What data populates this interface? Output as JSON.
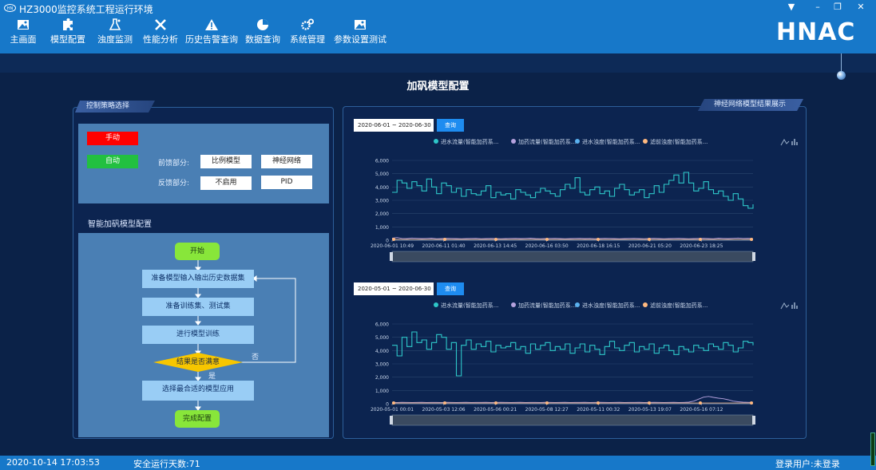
{
  "app": {
    "title": "HZ3000监控系统工程运行环境",
    "brand": "HNAC"
  },
  "window": {
    "dropdown": "▼",
    "minimize": "–",
    "restore": "❐",
    "close": "✕"
  },
  "menu": [
    {
      "label": "主画面",
      "icon": "picture-icon"
    },
    {
      "label": "模型配置",
      "icon": "puzzle-icon"
    },
    {
      "label": "浊度监测",
      "icon": "flask-icon"
    },
    {
      "label": "性能分析",
      "icon": "tools-icon"
    },
    {
      "label": "历史告警查询",
      "icon": "warning-icon"
    },
    {
      "label": "数据查询",
      "icon": "pie-chart-icon"
    },
    {
      "label": "系统管理",
      "icon": "gears-icon"
    },
    {
      "label": "参数设置测试",
      "icon": "picture-icon"
    }
  ],
  "page": {
    "title": "加矾模型配置"
  },
  "left": {
    "tab": "控制策略选择",
    "manual": "手动",
    "auto": "自动",
    "feedforward_label": "前馈部分:",
    "feedforward_a": "比例模型",
    "feedforward_b": "神经网络",
    "feedback_label": "反馈部分:",
    "feedback_a": "不启用",
    "feedback_b": "PID",
    "flow_title": "智能加矾模型配置",
    "flow": {
      "start": "开始",
      "s1": "准备模型输入输出历史数据集",
      "s2": "准备训练集、测试集",
      "s3": "进行模型训练",
      "decision": "结果是否满意",
      "yes": "是",
      "no": "否",
      "s4": "选择最合适的模型应用",
      "end": "完成配置"
    }
  },
  "right": {
    "tab": "神经网络模型结果展示",
    "query": "查询"
  },
  "colors": {
    "series1": "#2ec7c9",
    "series2": "#b6a2de",
    "series3": "#5ab1ef",
    "series4": "#ffb980",
    "manual": "#ff0000",
    "auto": "#22c040"
  },
  "chart_data": [
    {
      "type": "line",
      "date_range": "2020-06-01 ~ 2020-06-30",
      "legend": [
        "进水流量(智能加药系...",
        "加药流量(智能加药系...",
        "进水浊度(智能加药系...",
        "滤前浊度(智能加药系..."
      ],
      "yticks": [
        "6,000",
        "5,000",
        "4,000",
        "3,000",
        "2,000",
        "1,000",
        "0"
      ],
      "ylim": [
        0,
        6000
      ],
      "xticks": [
        "2020-06-01 10:49",
        "2020-06-11 01:40",
        "2020-06-13 14:45",
        "2020-06-16 03:50",
        "2020-06-18 16:15",
        "2020-06-21 05:20",
        "2020-06-23 18:25"
      ],
      "series": [
        {
          "name": "进水流量(智能加药系...",
          "values": [
            3600,
            4500,
            4300,
            3900,
            4400,
            4100,
            3700,
            4600,
            4000,
            3500,
            4300,
            4100,
            3600,
            3900,
            3300,
            3800,
            3500,
            3400,
            3700,
            4100,
            3200,
            3600,
            3400,
            3500,
            3100,
            3800,
            3600,
            3400,
            3200,
            3600,
            3900,
            3700,
            3500,
            3300,
            3800,
            4200,
            3900,
            4700,
            3600,
            3400,
            3800,
            4000,
            3500,
            3700,
            3300,
            3900,
            4200,
            3800,
            3400,
            3600,
            3800,
            3200,
            3500,
            4100,
            3600,
            4200,
            4500,
            4900,
            4300,
            5100,
            4300,
            3700,
            3900,
            4400,
            3800,
            3500,
            3700,
            3300,
            3000,
            3500,
            3100,
            2600,
            2400,
            2700
          ]
        },
        {
          "name": "加药流量(智能加药系...",
          "values": [
            150,
            200,
            130,
            120,
            160,
            140,
            120,
            130,
            150,
            110,
            120,
            140,
            130,
            120,
            110,
            120,
            130,
            140,
            110,
            120,
            130,
            120,
            110,
            120,
            130,
            140,
            120,
            130,
            150,
            120,
            110,
            120,
            130,
            140,
            120,
            110,
            120,
            130,
            140,
            120,
            130,
            110,
            120,
            140,
            130,
            120,
            110,
            120,
            130,
            140,
            120,
            110,
            130,
            140,
            120,
            110,
            120,
            130,
            140,
            120,
            110,
            120,
            130,
            140,
            120,
            110,
            150,
            130,
            120,
            140,
            160,
            130,
            140,
            120
          ]
        }
      ]
    },
    {
      "type": "line",
      "date_range": "2020-05-01 ~ 2020-06-30",
      "legend": [
        "进水流量(智能加药系...",
        "加药流量(智能加药系...",
        "进水浊度(智能加药系...",
        "滤前浊度(智能加药系..."
      ],
      "yticks": [
        "6,000",
        "5,000",
        "4,000",
        "3,000",
        "2,000",
        "1,000",
        "0"
      ],
      "ylim": [
        0,
        6000
      ],
      "xticks": [
        "2020-05-01 00:01",
        "2020-05-03 12:06",
        "2020-05-06 00:21",
        "2020-05-08 12:27",
        "2020-05-11 00:32",
        "2020-05-13 19:07",
        "2020-05-16 07:12"
      ],
      "series": [
        {
          "name": "进水流量(智能加药系...",
          "values": [
            4400,
            3600,
            5000,
            4300,
            5400,
            4600,
            4800,
            4100,
            4600,
            5200,
            5000,
            4100,
            4600,
            2100,
            4400,
            4800,
            4100,
            4500,
            4300,
            4700,
            3900,
            4400,
            4200,
            4300,
            4600,
            4100,
            4300,
            3800,
            4500,
            4100,
            4400,
            4600,
            4000,
            4300,
            4100,
            4500,
            3800,
            4200,
            4500,
            3900,
            4400,
            4100,
            3700,
            4300,
            4700,
            4200,
            4000,
            4400,
            4600,
            3900,
            4300,
            4100,
            4500,
            3800,
            4200,
            4400,
            4000,
            3700,
            4300,
            4100,
            3900,
            4400,
            4200,
            4000,
            4500,
            4300,
            4100,
            4600,
            4400,
            3900,
            4200,
            4700,
            4600,
            4400
          ]
        },
        {
          "name": "加药流量(智能加药系...",
          "values": [
            100,
            90,
            110,
            100,
            90,
            100,
            110,
            90,
            100,
            100,
            90,
            110,
            100,
            90,
            100,
            110,
            90,
            100,
            100,
            110,
            90,
            100,
            110,
            100,
            90,
            100,
            110,
            90,
            100,
            100,
            90,
            110,
            100,
            90,
            100,
            110,
            90,
            100,
            100,
            110,
            90,
            100,
            110,
            100,
            90,
            100,
            110,
            90,
            100,
            100,
            110,
            90,
            100,
            110,
            100,
            90,
            100,
            110,
            90,
            100,
            120,
            200,
            350,
            500,
            550,
            480,
            420,
            380,
            300,
            200,
            150,
            120,
            110,
            100
          ]
        }
      ]
    }
  ]
}
